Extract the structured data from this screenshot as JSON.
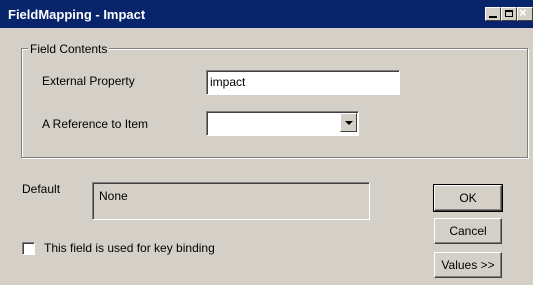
{
  "window": {
    "title": "FieldMapping - Impact"
  },
  "field_contents": {
    "group_label": "Field Contents",
    "external_property_label": "External Property",
    "external_property_value": "impact",
    "reference_label": "A Reference to Item",
    "reference_value": ""
  },
  "default": {
    "label": "Default",
    "value": "None"
  },
  "key_binding": {
    "label": "This field is used for key binding",
    "checked": false
  },
  "buttons": {
    "ok": "OK",
    "cancel": "Cancel",
    "values": "Values >>"
  }
}
